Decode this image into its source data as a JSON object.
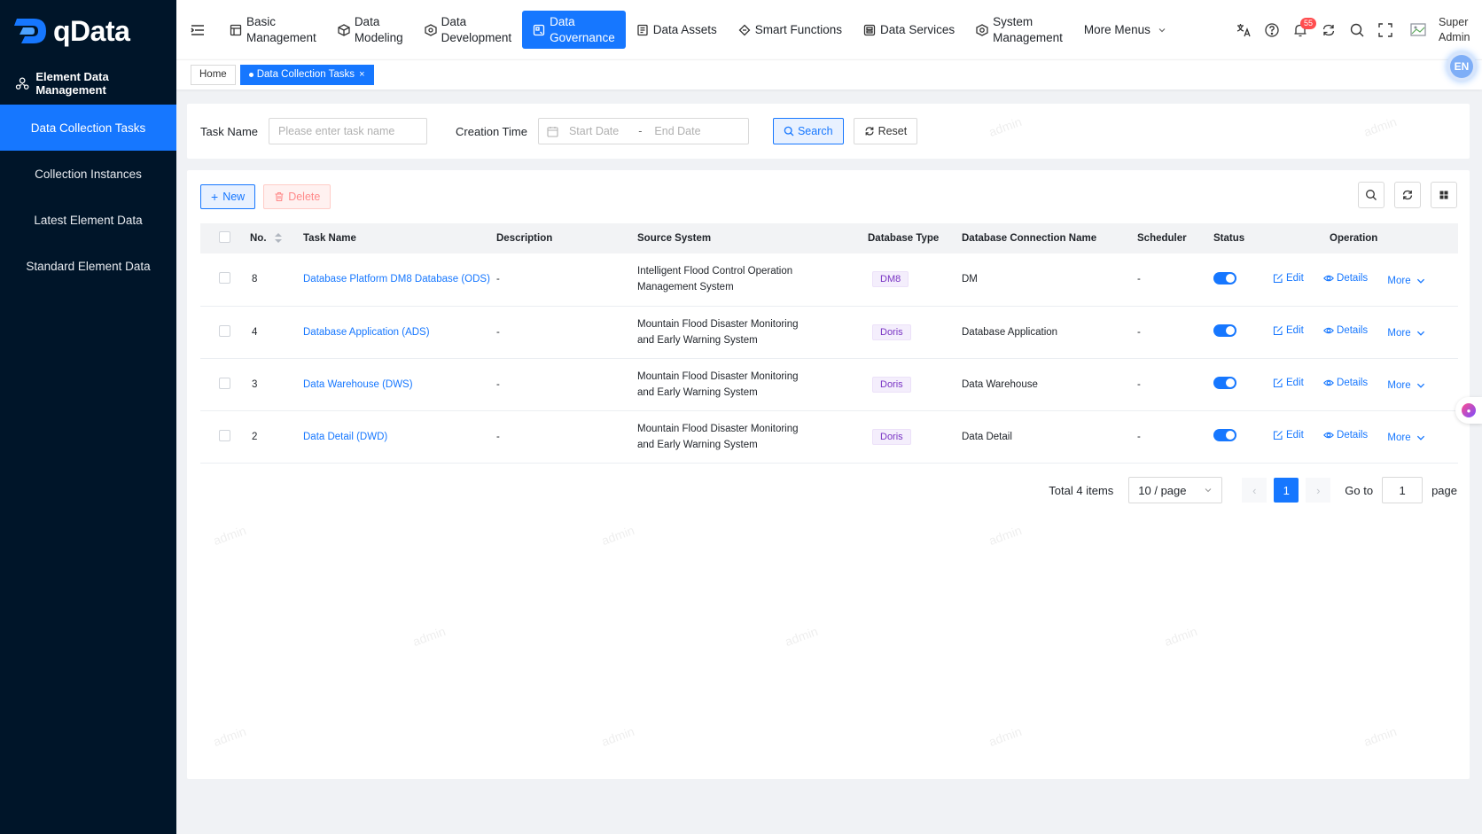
{
  "app": {
    "name": "qData"
  },
  "sidebar": {
    "group": {
      "label": "Element Data Management",
      "icon": "users-icon"
    },
    "items": [
      {
        "label": "Data Collection Tasks",
        "active": true
      },
      {
        "label": "Collection Instances",
        "active": false
      },
      {
        "label": "Latest Element Data",
        "active": false
      },
      {
        "label": "Standard Element Data",
        "active": false
      }
    ]
  },
  "topnav": {
    "items": [
      {
        "label": "Basic\nManagement",
        "icon": "layout-icon"
      },
      {
        "label": "Data\nModeling",
        "icon": "cube-icon"
      },
      {
        "label": "Data\nDevelopment",
        "icon": "hexagon-icon"
      },
      {
        "label": "Data\nGovernance",
        "icon": "governance-icon",
        "active": true
      },
      {
        "label": "Data Assets",
        "icon": "assets-icon"
      },
      {
        "label": "Smart Functions",
        "icon": "smart-icon"
      },
      {
        "label": "Data Services",
        "icon": "services-icon"
      },
      {
        "label": "System\nManagement",
        "icon": "system-icon"
      }
    ],
    "more_label": "More Menus",
    "notification_count": "55",
    "user": {
      "line1": "Super",
      "line2": "Admin"
    },
    "lang_label": "EN"
  },
  "tabs": [
    {
      "label": "Home",
      "active": false
    },
    {
      "label": "Data Collection Tasks",
      "active": true
    }
  ],
  "search": {
    "task_name_label": "Task Name",
    "task_name_placeholder": "Please enter task name",
    "creation_time_label": "Creation Time",
    "start_placeholder": "Start Date",
    "end_placeholder": "End Date",
    "range_separator": "-",
    "search_button": "Search",
    "reset_button": "Reset"
  },
  "toolbar": {
    "new_button": "New",
    "delete_button": "Delete"
  },
  "table": {
    "columns": {
      "no": "No.",
      "task_name": "Task Name",
      "description": "Description",
      "source_system": "Source System",
      "db_type": "Database Type",
      "db_conn": "Database Connection Name",
      "scheduler": "Scheduler",
      "status": "Status",
      "operation": "Operation"
    },
    "rows": [
      {
        "no": "8",
        "task_name": "Database Platform DM8 Database (ODS)",
        "description": "-",
        "source_line1": "Intelligent Flood Control Operation",
        "source_line2": "Management System",
        "db_type": "DM8",
        "db_conn": "DM",
        "scheduler": "-",
        "status_on": true
      },
      {
        "no": "4",
        "task_name": "Database Application (ADS)",
        "description": "-",
        "source_line1": "Mountain Flood Disaster Monitoring",
        "source_line2": "and Early Warning System",
        "db_type": "Doris",
        "db_conn": "Database Application",
        "scheduler": "-",
        "status_on": true
      },
      {
        "no": "3",
        "task_name": "Data Warehouse (DWS)",
        "description": "-",
        "source_line1": "Mountain Flood Disaster Monitoring",
        "source_line2": "and Early Warning System",
        "db_type": "Doris",
        "db_conn": "Data Warehouse",
        "scheduler": "-",
        "status_on": true
      },
      {
        "no": "2",
        "task_name": "Data Detail (DWD)",
        "description": "-",
        "source_line1": "Mountain Flood Disaster Monitoring",
        "source_line2": "and Early Warning System",
        "db_type": "Doris",
        "db_conn": "Data Detail",
        "scheduler": "-",
        "status_on": true
      }
    ],
    "ops": {
      "edit": "Edit",
      "details": "Details",
      "more": "More"
    }
  },
  "pagination": {
    "total": "Total 4 items",
    "page_size": "10 / page",
    "current": "1",
    "goto_label": "Go to",
    "goto_value": "1",
    "page_label": "page"
  },
  "watermark_text": "admin",
  "colors": {
    "primary": "#1677ff",
    "sidebar_bg": "#001529",
    "tag_purple": "#7a35c4",
    "danger": "#ff4d4f"
  }
}
